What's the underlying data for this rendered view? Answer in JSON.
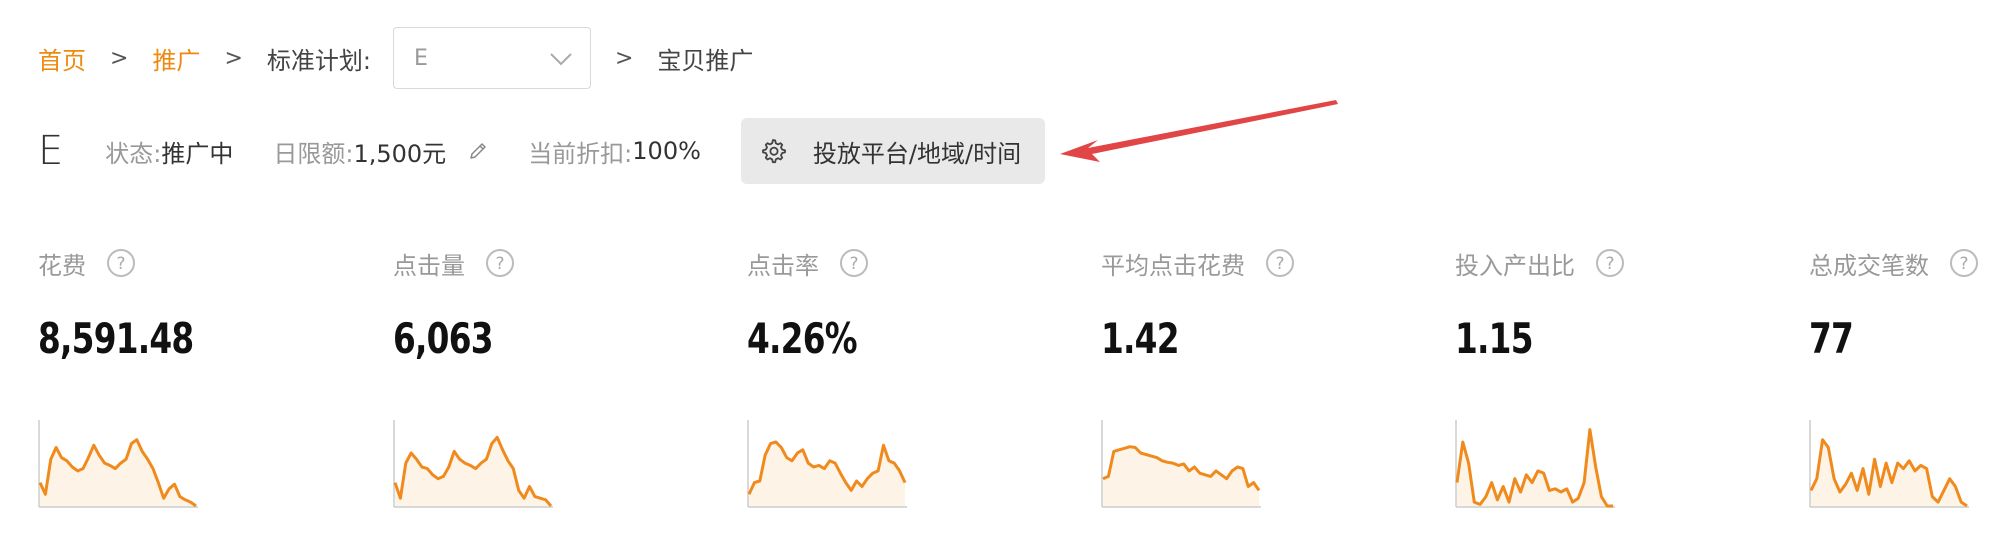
{
  "breadcrumb": {
    "home": "首页",
    "promote": "推广",
    "plan_label": "标准计划:",
    "plan_value": "E",
    "current": "宝贝推广",
    "separator": ">"
  },
  "plan": {
    "name": "E",
    "status_label": "状态:",
    "status_value": "推广中",
    "budget_label": "日限额:",
    "budget_value": "1,500元",
    "discount_label": "当前折扣:",
    "discount_value": "100%",
    "platform_button": "投放平台/地域/时间"
  },
  "colors": {
    "accent": "#ef8a10",
    "sparkline": "#f08a1c",
    "sparkline_fill": "#fdf3e6",
    "arrow": "#e24545",
    "button_bg": "#e9e9e9"
  },
  "metrics": [
    {
      "label": "花费",
      "value": "8,591.48"
    },
    {
      "label": "点击量",
      "value": "6,063"
    },
    {
      "label": "点击率",
      "value": "4.26%"
    },
    {
      "label": "平均点击花费",
      "value": "1.42"
    },
    {
      "label": "投入产出比",
      "value": "1.15"
    },
    {
      "label": "总成交笔数",
      "value": "77"
    }
  ],
  "sparklines": [
    [
      0.3,
      0.15,
      0.6,
      0.75,
      0.62,
      0.58,
      0.5,
      0.45,
      0.48,
      0.62,
      0.78,
      0.65,
      0.55,
      0.52,
      0.48,
      0.55,
      0.6,
      0.8,
      0.85,
      0.7,
      0.6,
      0.48,
      0.3,
      0.1,
      0.22,
      0.28,
      0.12,
      0.08,
      0.05,
      0.0
    ],
    [
      0.3,
      0.1,
      0.55,
      0.68,
      0.6,
      0.5,
      0.48,
      0.4,
      0.35,
      0.38,
      0.5,
      0.7,
      0.6,
      0.55,
      0.52,
      0.48,
      0.55,
      0.6,
      0.8,
      0.88,
      0.72,
      0.58,
      0.48,
      0.2,
      0.1,
      0.25,
      0.12,
      0.1,
      0.08,
      0.0
    ],
    [
      0.15,
      0.3,
      0.32,
      0.65,
      0.8,
      0.82,
      0.75,
      0.62,
      0.58,
      0.68,
      0.72,
      0.55,
      0.5,
      0.52,
      0.48,
      0.58,
      0.55,
      0.42,
      0.3,
      0.2,
      0.32,
      0.25,
      0.35,
      0.42,
      0.45,
      0.78,
      0.58,
      0.55,
      0.45,
      0.3
    ],
    [
      0.35,
      0.38,
      0.7,
      0.72,
      0.74,
      0.76,
      0.75,
      0.68,
      0.66,
      0.64,
      0.62,
      0.58,
      0.56,
      0.55,
      0.52,
      0.54,
      0.45,
      0.5,
      0.42,
      0.4,
      0.38,
      0.45,
      0.4,
      0.35,
      0.45,
      0.5,
      0.48,
      0.25,
      0.3,
      0.2
    ],
    [
      0.3,
      0.82,
      0.55,
      0.05,
      0.02,
      0.12,
      0.3,
      0.08,
      0.25,
      0.05,
      0.35,
      0.18,
      0.4,
      0.3,
      0.45,
      0.42,
      0.2,
      0.22,
      0.18,
      0.22,
      0.05,
      0.1,
      0.3,
      0.98,
      0.5,
      0.12,
      0.0,
      0.0
    ],
    [
      0.2,
      0.35,
      0.85,
      0.75,
      0.35,
      0.18,
      0.28,
      0.42,
      0.2,
      0.48,
      0.15,
      0.6,
      0.25,
      0.55,
      0.3,
      0.55,
      0.48,
      0.58,
      0.45,
      0.52,
      0.48,
      0.12,
      0.05,
      0.2,
      0.35,
      0.25,
      0.05,
      0.0
    ]
  ]
}
